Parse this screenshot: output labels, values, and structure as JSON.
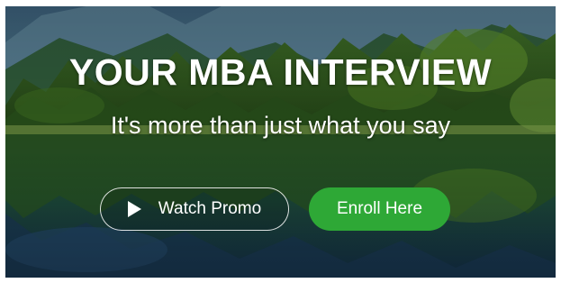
{
  "hero": {
    "headline": "YOUR MBA INTERVIEW",
    "subheadline": "It's more than just what you say",
    "watch_promo_label": "Watch Promo",
    "enroll_label": "Enroll Here",
    "background": "mountain-lake-forest-photo"
  },
  "icons": {
    "play": "play-icon"
  },
  "colors": {
    "enroll_button": "#2ea836",
    "text": "#ffffff",
    "watch_border": "#ffffff"
  }
}
